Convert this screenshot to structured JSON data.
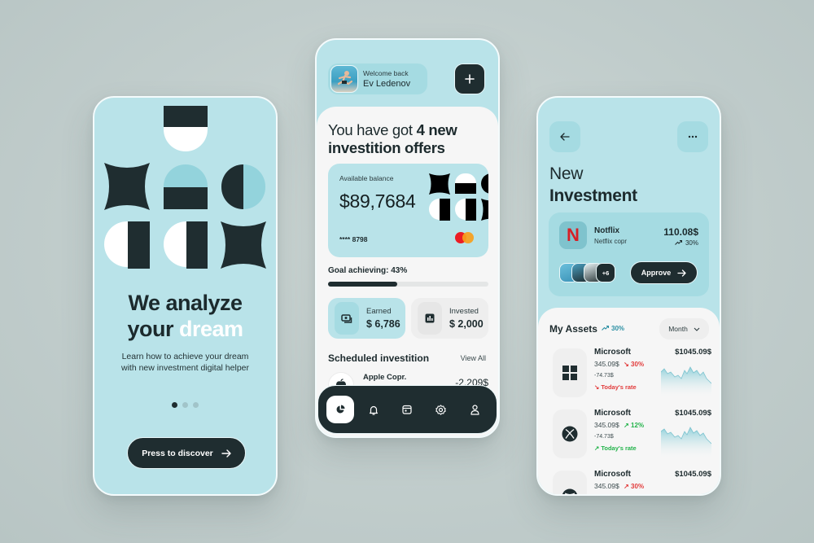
{
  "colors": {
    "accent_light": "#b9e3e9",
    "accent_mid": "#a5dbe2",
    "dark": "#1f2d30",
    "sheet": "#f6f6f6",
    "positive": "#22b34a",
    "negative": "#e23b3b",
    "teal_text": "#2a8fa3"
  },
  "onboarding": {
    "headline_line1": "We analyze",
    "headline_line2_a": "your",
    "headline_line2_b": "dream",
    "subtitle_line1": "Learn how to achieve your dream",
    "subtitle_line2": "with new investment digital helper",
    "pagination": {
      "total": 3,
      "active": 1
    },
    "cta_label": "Press to discover",
    "cta_icon": "arrow-right-icon"
  },
  "dashboard": {
    "welcome_label": "Welcome back",
    "user_name": "Ev Ledenov",
    "add_icon": "plus-icon",
    "offers_prefix": "You have got",
    "offers_bold": "4 new",
    "offers_line2": "investition offers",
    "balance_label": "Available balance",
    "balance_value": "$89,7684",
    "card_number": "**** 8798",
    "card_brand": "mastercard",
    "goal_label": "Goal achieving: 43%",
    "goal_progress": 0.43,
    "stats": [
      {
        "label": "Earned",
        "value": "$ 6,786",
        "icon": "money-icon",
        "highlighted": true
      },
      {
        "label": "Invested",
        "value": "$ 2,000",
        "icon": "chart-bars-icon",
        "highlighted": false
      }
    ],
    "scheduled_title": "Scheduled investition",
    "view_all": "View All",
    "scheduled_items": [
      {
        "name": "Apple Copr.",
        "value": "-2,209$",
        "icon": "apple-icon"
      }
    ],
    "nav": [
      {
        "name": "pie-chart",
        "icon": "pie-chart-icon",
        "active": true
      },
      {
        "name": "notifications",
        "icon": "bell-icon",
        "active": false
      },
      {
        "name": "calendar",
        "icon": "calendar-icon",
        "active": false
      },
      {
        "name": "settings",
        "icon": "gear-icon",
        "active": false
      },
      {
        "name": "profile",
        "icon": "user-icon",
        "active": false
      }
    ]
  },
  "investment": {
    "back_icon": "arrow-left-icon",
    "more_icon": "more-horizontal-icon",
    "title_light": "New",
    "title_bold": "Investment",
    "offer": {
      "logo_letter": "N",
      "name": "Notflix",
      "company": "Netflix copr",
      "price": "110.08$",
      "change": "30%",
      "extra_investors": "+6",
      "approve_label": "Approve"
    },
    "assets_title": "My Assets",
    "assets_change": "30%",
    "period": "Month",
    "assets": [
      {
        "name": "Microsoft",
        "price": "345.09$",
        "change": "30%",
        "direction": "down",
        "small": "-74.73$",
        "rate_label": "Today's rate",
        "total": "$1045.09$",
        "logo": "windows-icon"
      },
      {
        "name": "Microsoft",
        "price": "345.09$",
        "change": "12%",
        "direction": "up",
        "small": "-74.73$",
        "rate_label": "Today's rate",
        "total": "$1045.09$",
        "logo": "xbox-icon"
      },
      {
        "name": "Microsoft",
        "price": "345.09$",
        "change": "30%",
        "direction": "up-red",
        "small": "",
        "rate_label": "",
        "total": "$1045.09$",
        "logo": "globe-icon"
      }
    ]
  }
}
